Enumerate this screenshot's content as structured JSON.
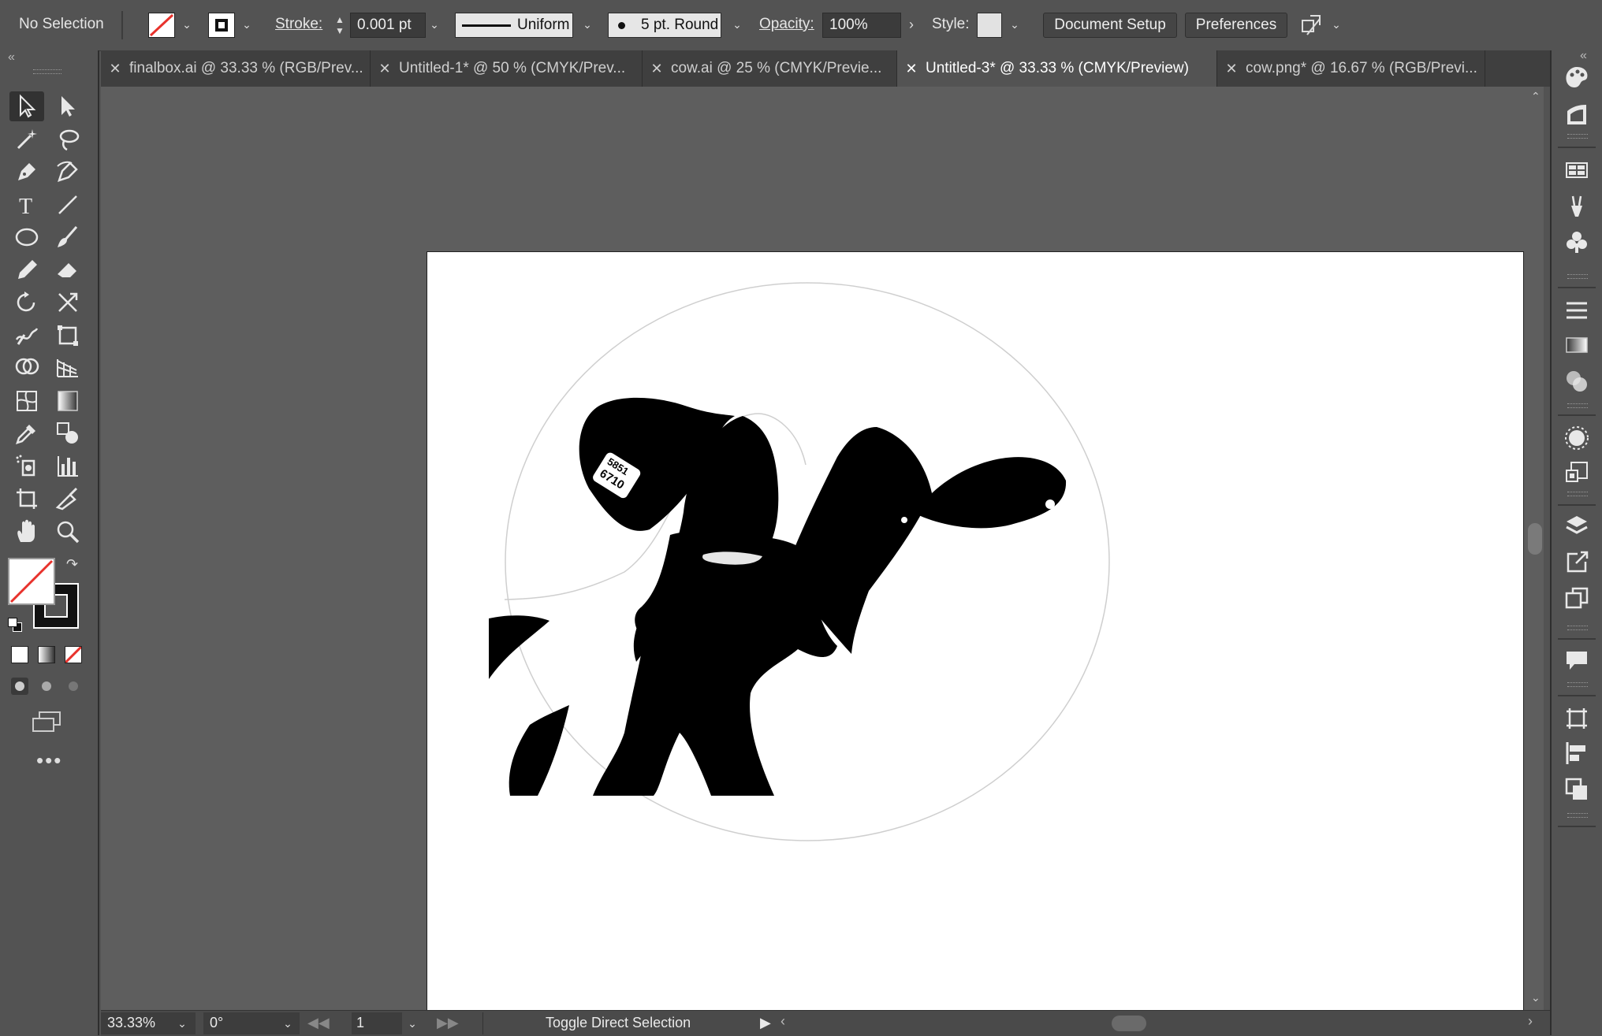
{
  "control_bar": {
    "selection_status": "No Selection",
    "stroke_label": "Stroke:",
    "stroke_weight": "0.001 pt",
    "stroke_profile": "Uniform",
    "brush": "5 pt. Round",
    "opacity_label": "Opacity:",
    "opacity_value": "100%",
    "style_label": "Style:",
    "document_setup_label": "Document Setup",
    "preferences_label": "Preferences"
  },
  "tabs": [
    {
      "label": "finalbox.ai @ 33.33 % (RGB/Prev...",
      "active": false
    },
    {
      "label": "Untitled-1* @ 50 % (CMYK/Prev...",
      "active": false
    },
    {
      "label": "cow.ai @ 25 % (CMYK/Previe...",
      "active": false
    },
    {
      "label": "Untitled-3* @ 33.33 % (CMYK/Preview)",
      "active": true
    },
    {
      "label": "cow.png* @ 16.67 % (RGB/Previ...",
      "active": false
    }
  ],
  "tools": [
    "selection-tool-icon",
    "direct-selection-tool-icon",
    "magic-wand-tool-icon",
    "lasso-tool-icon",
    "pen-tool-icon",
    "curvature-tool-icon",
    "type-tool-icon",
    "line-segment-tool-icon",
    "ellipse-tool-icon",
    "paintbrush-tool-icon",
    "pencil-tool-icon",
    "eraser-tool-icon",
    "rotate-tool-icon",
    "scale-tool-icon",
    "warp-tool-icon",
    "free-transform-tool-icon",
    "shape-builder-tool-icon",
    "perspective-grid-tool-icon",
    "mesh-tool-icon",
    "gradient-tool-icon",
    "eyedropper-tool-icon",
    "blend-tool-icon",
    "symbol-sprayer-tool-icon",
    "column-graph-tool-icon",
    "artboard-tool-icon",
    "slice-tool-icon",
    "hand-tool-icon",
    "zoom-tool-icon"
  ],
  "right_dock": [
    "color-panel-icon",
    "color-guide-panel-icon",
    "swatches-panel-icon",
    "brushes-panel-icon",
    "symbols-panel-icon",
    "stroke-panel-icon",
    "gradient-panel-icon",
    "transparency-panel-icon",
    "appearance-panel-icon",
    "graphic-styles-panel-icon",
    "layers-panel-icon",
    "asset-export-panel-icon",
    "artboards-panel-icon",
    "comments-panel-icon",
    "transform-panel-icon",
    "align-panel-icon",
    "pathfinder-panel-icon"
  ],
  "ear_tag": {
    "line1": "5851",
    "line2": "6710"
  },
  "status_bar": {
    "zoom": "33.33%",
    "rotation": "0°",
    "artboard_number": "1",
    "status_text": "Toggle Direct Selection"
  },
  "colors": {
    "ui_background": "#535353",
    "tab_bar": "#3f3f3f",
    "canvas": "#5e5e5e",
    "artboard": "#ffffff",
    "none_swatch_red": "#e8322c"
  }
}
